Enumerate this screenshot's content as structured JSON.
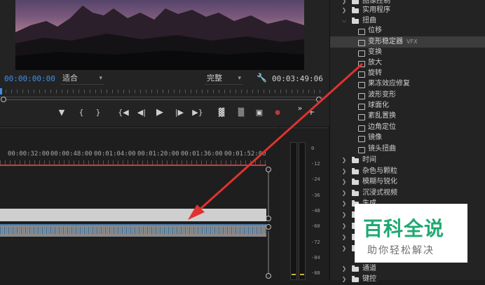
{
  "monitor": {
    "timecode_current": "00:00:00:00",
    "timecode_duration": "00:03:49:06",
    "zoom": "适合",
    "quality": "完整"
  },
  "transport": {
    "marker_icon": "marker-icon",
    "in_icon": "mark-in-icon",
    "out_icon": "mark-out-icon",
    "goto_in_icon": "go-to-in-icon",
    "step_back_icon": "step-back-icon",
    "play_icon": "play-icon",
    "step_forward_icon": "step-forward-icon",
    "goto_out_icon": "go-to-out-icon",
    "lift_icon": "lift-icon",
    "extract_icon": "extract-icon",
    "export_frame_icon": "camera-icon",
    "record_icon": "record-icon",
    "more_icon": "more-icon",
    "add_icon": "add-icon",
    "record_color": "#b83a3a"
  },
  "timeline": {
    "ruler": [
      "00:00:32:00",
      "00:00:48:00",
      "00:01:04:00",
      "00:01:20:00",
      "00:01:36:00",
      "00:01:52:00"
    ],
    "work_area_color": "#d03a3a"
  },
  "meters": {
    "db": [
      "0",
      "-12",
      "-24",
      "-36",
      "-48",
      "-60",
      "-72",
      "-84",
      "-88"
    ]
  },
  "effects": {
    "top_folders": [
      {
        "label": "图像控制",
        "expanded": false
      },
      {
        "label": "实用程序",
        "expanded": false
      },
      {
        "label": "扭曲",
        "expanded": true
      }
    ],
    "distort_items": [
      {
        "label": "位移",
        "tag": ""
      },
      {
        "label": "变形稳定器",
        "tag": "VFX"
      },
      {
        "label": "变换",
        "tag": ""
      },
      {
        "label": "放大",
        "tag": ""
      },
      {
        "label": "旋转",
        "tag": ""
      },
      {
        "label": "果冻效应修复",
        "tag": ""
      },
      {
        "label": "波形变形",
        "tag": ""
      },
      {
        "label": "球面化",
        "tag": ""
      },
      {
        "label": "紊乱置换",
        "tag": ""
      },
      {
        "label": "边角定位",
        "tag": ""
      },
      {
        "label": "镜像",
        "tag": ""
      },
      {
        "label": "镜头扭曲",
        "tag": ""
      }
    ],
    "bottom_folders": [
      {
        "label": "时间"
      },
      {
        "label": "杂色与颗粒"
      },
      {
        "label": "模糊与锐化"
      },
      {
        "label": "沉浸式视频"
      },
      {
        "label": "生成"
      },
      {
        "label": ""
      },
      {
        "label": ""
      },
      {
        "label": ""
      },
      {
        "label": ""
      },
      {
        "label": "通道"
      },
      {
        "label": "键控"
      }
    ]
  },
  "annotation": {
    "arrow_color": "#e0322f"
  },
  "watermark": {
    "title": "百科全说",
    "subtitle": "助你轻松解决",
    "brand_color": "#1fa971"
  }
}
